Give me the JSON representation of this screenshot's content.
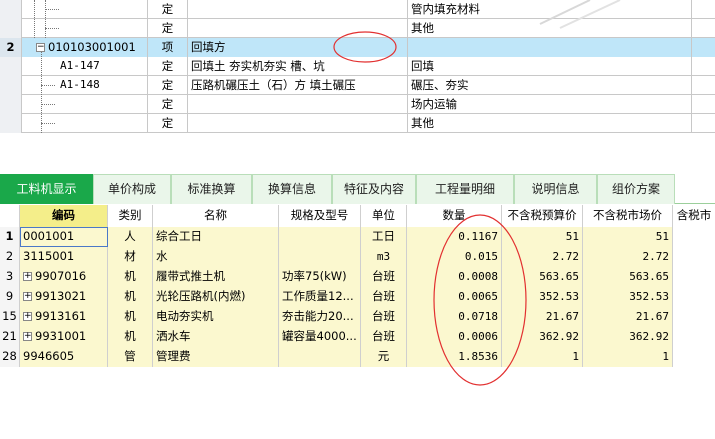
{
  "top_grid": {
    "rows": [
      {
        "num": "",
        "code": "",
        "type": "定",
        "name": "",
        "unit": "管内填充材料",
        "selected": false
      },
      {
        "num": "",
        "code": "",
        "type": "定",
        "name": "",
        "unit": "其他",
        "selected": false
      },
      {
        "num": "2",
        "code": "010103001001",
        "type": "项",
        "name": "回填方",
        "unit": "",
        "selected": true
      },
      {
        "num": "",
        "code": "A1-147",
        "type": "定",
        "name": "回填土 夯实机夯实 槽、坑",
        "unit": "回填",
        "selected": false
      },
      {
        "num": "",
        "code": "A1-148",
        "type": "定",
        "name": "压路机碾压土（石）方 填土碾压",
        "unit": "碾压、夯实",
        "selected": false
      },
      {
        "num": "",
        "code": "",
        "type": "定",
        "name": "",
        "unit": "场内运输",
        "selected": false
      },
      {
        "num": "",
        "code": "",
        "type": "定",
        "name": "",
        "unit": "其他",
        "selected": false
      }
    ]
  },
  "tabs": [
    {
      "label": "工料机显示",
      "active": true
    },
    {
      "label": "单价构成",
      "active": false
    },
    {
      "label": "标准换算",
      "active": false
    },
    {
      "label": "换算信息",
      "active": false
    },
    {
      "label": "特征及内容",
      "active": false
    },
    {
      "label": "工程量明细",
      "active": false
    },
    {
      "label": "说明信息",
      "active": false
    },
    {
      "label": "组价方案",
      "active": false
    }
  ],
  "bottom_grid": {
    "headers": {
      "code": "编码",
      "category": "类别",
      "name": "名称",
      "spec": "规格及型号",
      "unit": "单位",
      "qty": "数量",
      "budget_price": "不含税预算价",
      "market_price": "不含税市场价",
      "tax_price": "含税市"
    },
    "rows": [
      {
        "num": "1",
        "expand": false,
        "code": "0001001",
        "category": "人",
        "name": "综合工日",
        "spec": "",
        "unit": "工日",
        "qty": "0.1167",
        "budget_price": "51",
        "market_price": "51"
      },
      {
        "num": "2",
        "expand": false,
        "code": "3115001",
        "category": "材",
        "name": "水",
        "spec": "",
        "unit": "m3",
        "qty": "0.015",
        "budget_price": "2.72",
        "market_price": "2.72"
      },
      {
        "num": "3",
        "expand": true,
        "code": "9907016",
        "category": "机",
        "name": "履带式推土机",
        "spec": "功率75(kW)",
        "unit": "台班",
        "qty": "0.0008",
        "budget_price": "563.65",
        "market_price": "563.65"
      },
      {
        "num": "9",
        "expand": true,
        "code": "9913021",
        "category": "机",
        "name": "光轮压路机(内燃)",
        "spec": "工作质量12...",
        "unit": "台班",
        "qty": "0.0065",
        "budget_price": "352.53",
        "market_price": "352.53"
      },
      {
        "num": "15",
        "expand": true,
        "code": "9913161",
        "category": "机",
        "name": "电动夯实机",
        "spec": "夯击能力20...",
        "unit": "台班",
        "qty": "0.0718",
        "budget_price": "21.67",
        "market_price": "21.67"
      },
      {
        "num": "21",
        "expand": true,
        "code": "9931001",
        "category": "机",
        "name": "洒水车",
        "spec": "罐容量4000...",
        "unit": "台班",
        "qty": "0.0006",
        "budget_price": "362.92",
        "market_price": "362.92"
      },
      {
        "num": "28",
        "expand": false,
        "code": "9946605",
        "category": "管",
        "name": "管理费",
        "spec": "",
        "unit": "元",
        "qty": "1.8536",
        "budget_price": "1",
        "market_price": "1"
      }
    ]
  },
  "colors": {
    "tab_active": "#1aa84a",
    "selected_row": "#bfe6f9",
    "data_row": "#fbf8cf",
    "annotation_red": "#e23030"
  }
}
